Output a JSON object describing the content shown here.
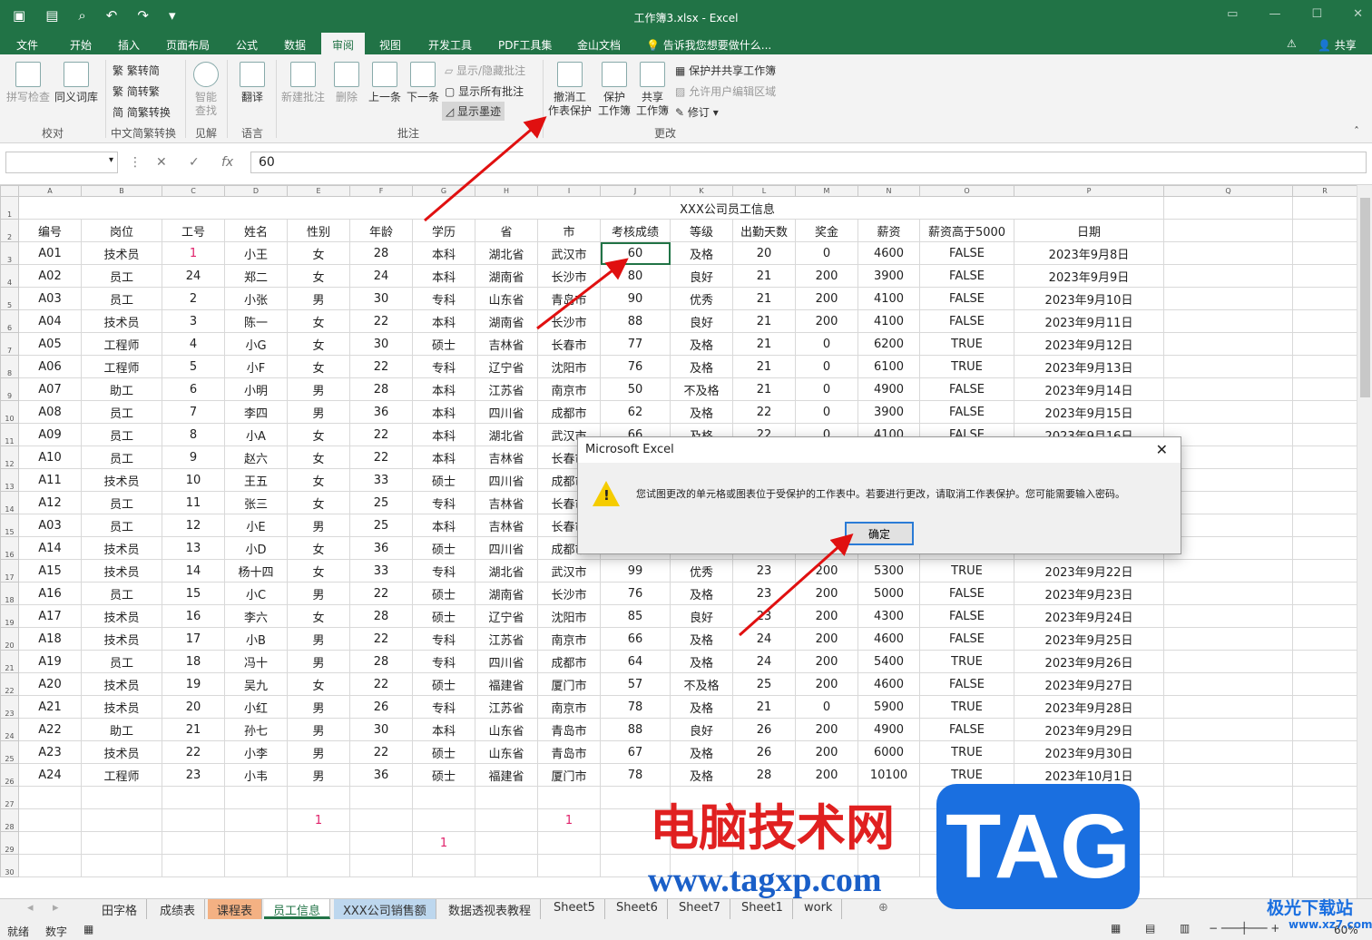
{
  "window": {
    "title": "工作簿3.xlsx - Excel"
  },
  "menu": [
    "文件",
    "开始",
    "插入",
    "页面布局",
    "公式",
    "数据",
    "审阅",
    "视图",
    "开发工具",
    "PDF工具集",
    "金山文档"
  ],
  "tell_me": "告诉我您想要做什么...",
  "share": "共享",
  "ribbon": {
    "spell": "拼写检查",
    "thesaurus": "同义词库",
    "group_proof": "校对",
    "t2s": "繁转简",
    "s2t": "简转繁",
    "conv": "简繁转换",
    "group_chinese": "中文简繁转换",
    "smart1": "智能",
    "smart2": "查找",
    "group_insight": "见解",
    "translate": "翻译",
    "group_lang": "语言",
    "new_comment": "新建批注",
    "delete": "删除",
    "prev": "上一条",
    "next": "下一条",
    "show_hide": "显示/隐藏批注",
    "show_all": "显示所有批注",
    "show_ink": "显示墨迹",
    "group_comments": "批注",
    "unprotect1": "撤消工",
    "unprotect2": "作表保护",
    "protect1": "保护",
    "protect2": "工作簿",
    "share1": "共享",
    "share2": "工作簿",
    "protect_share": "保护并共享工作簿",
    "allow_edit": "允许用户编辑区域",
    "track": "修订",
    "group_changes": "更改"
  },
  "formula": {
    "value": "60"
  },
  "columns": [
    "A",
    "B",
    "C",
    "D",
    "E",
    "F",
    "G",
    "H",
    "I",
    "J",
    "K",
    "L",
    "M",
    "N",
    "O",
    "P",
    "Q",
    "R"
  ],
  "sheet_title": "XXX公司员工信息",
  "headers": [
    "编号",
    "岗位",
    "工号",
    "姓名",
    "性别",
    "年龄",
    "学历",
    "省",
    "市",
    "考核成绩",
    "等级",
    "出勤天数",
    "奖金",
    "薪资",
    "薪资高于5000",
    "日期"
  ],
  "rows": [
    [
      "A01",
      "技术员",
      "1",
      "小王",
      "女",
      "28",
      "本科",
      "湖北省",
      "武汉市",
      "60",
      "及格",
      "20",
      "0",
      "4600",
      "FALSE",
      "2023年9月8日"
    ],
    [
      "A02",
      "员工",
      "24",
      "郑二",
      "女",
      "24",
      "本科",
      "湖南省",
      "长沙市",
      "80",
      "良好",
      "21",
      "200",
      "3900",
      "FALSE",
      "2023年9月9日"
    ],
    [
      "A03",
      "员工",
      "2",
      "小张",
      "男",
      "30",
      "专科",
      "山东省",
      "青岛市",
      "90",
      "优秀",
      "21",
      "200",
      "4100",
      "FALSE",
      "2023年9月10日"
    ],
    [
      "A04",
      "技术员",
      "3",
      "陈一",
      "女",
      "22",
      "本科",
      "湖南省",
      "长沙市",
      "88",
      "良好",
      "21",
      "200",
      "4100",
      "FALSE",
      "2023年9月11日"
    ],
    [
      "A05",
      "工程师",
      "4",
      "小G",
      "女",
      "30",
      "硕士",
      "吉林省",
      "长春市",
      "77",
      "及格",
      "21",
      "0",
      "6200",
      "TRUE",
      "2023年9月12日"
    ],
    [
      "A06",
      "工程师",
      "5",
      "小F",
      "女",
      "22",
      "专科",
      "辽宁省",
      "沈阳市",
      "76",
      "及格",
      "21",
      "0",
      "6100",
      "TRUE",
      "2023年9月13日"
    ],
    [
      "A07",
      "助工",
      "6",
      "小明",
      "男",
      "28",
      "本科",
      "江苏省",
      "南京市",
      "50",
      "不及格",
      "21",
      "0",
      "4900",
      "FALSE",
      "2023年9月14日"
    ],
    [
      "A08",
      "员工",
      "7",
      "李四",
      "男",
      "36",
      "本科",
      "四川省",
      "成都市",
      "62",
      "及格",
      "22",
      "0",
      "3900",
      "FALSE",
      "2023年9月15日"
    ],
    [
      "A09",
      "员工",
      "8",
      "小A",
      "女",
      "22",
      "本科",
      "湖北省",
      "武汉市",
      "66",
      "及格",
      "22",
      "0",
      "4100",
      "FALSE",
      "2023年9月16日"
    ],
    [
      "A10",
      "员工",
      "9",
      "赵六",
      "女",
      "22",
      "本科",
      "吉林省",
      "长春市",
      "",
      "",
      "",
      "",
      "",
      "",
      ""
    ],
    [
      "A11",
      "技术员",
      "10",
      "王五",
      "女",
      "33",
      "硕士",
      "四川省",
      "成都市",
      "",
      "",
      "",
      "",
      "",
      "",
      ""
    ],
    [
      "A12",
      "员工",
      "11",
      "张三",
      "女",
      "25",
      "专科",
      "吉林省",
      "长春市",
      "",
      "",
      "",
      "",
      "",
      "",
      ""
    ],
    [
      "A03",
      "员工",
      "12",
      "小E",
      "男",
      "25",
      "本科",
      "吉林省",
      "长春市",
      "",
      "",
      "",
      "",
      "",
      "",
      ""
    ],
    [
      "A14",
      "技术员",
      "13",
      "小D",
      "女",
      "36",
      "硕士",
      "四川省",
      "成都市",
      "",
      "",
      "",
      "",
      "",
      "",
      ""
    ],
    [
      "A15",
      "技术员",
      "14",
      "杨十四",
      "女",
      "33",
      "专科",
      "湖北省",
      "武汉市",
      "99",
      "优秀",
      "23",
      "200",
      "5300",
      "TRUE",
      "2023年9月22日"
    ],
    [
      "A16",
      "员工",
      "15",
      "小C",
      "男",
      "22",
      "硕士",
      "湖南省",
      "长沙市",
      "76",
      "及格",
      "23",
      "200",
      "5000",
      "FALSE",
      "2023年9月23日"
    ],
    [
      "A17",
      "技术员",
      "16",
      "李六",
      "女",
      "28",
      "硕士",
      "辽宁省",
      "沈阳市",
      "85",
      "良好",
      "23",
      "200",
      "4300",
      "FALSE",
      "2023年9月24日"
    ],
    [
      "A18",
      "技术员",
      "17",
      "小B",
      "男",
      "22",
      "专科",
      "江苏省",
      "南京市",
      "66",
      "及格",
      "24",
      "200",
      "4600",
      "FALSE",
      "2023年9月25日"
    ],
    [
      "A19",
      "员工",
      "18",
      "冯十",
      "男",
      "28",
      "专科",
      "四川省",
      "成都市",
      "64",
      "及格",
      "24",
      "200",
      "5400",
      "TRUE",
      "2023年9月26日"
    ],
    [
      "A20",
      "技术员",
      "19",
      "吴九",
      "女",
      "22",
      "硕士",
      "福建省",
      "厦门市",
      "57",
      "不及格",
      "25",
      "200",
      "4600",
      "FALSE",
      "2023年9月27日"
    ],
    [
      "A21",
      "技术员",
      "20",
      "小红",
      "男",
      "26",
      "专科",
      "江苏省",
      "南京市",
      "78",
      "及格",
      "21",
      "0",
      "5900",
      "TRUE",
      "2023年9月28日"
    ],
    [
      "A22",
      "助工",
      "21",
      "孙七",
      "男",
      "30",
      "本科",
      "山东省",
      "青岛市",
      "88",
      "良好",
      "26",
      "200",
      "4900",
      "FALSE",
      "2023年9月29日"
    ],
    [
      "A23",
      "技术员",
      "22",
      "小李",
      "男",
      "22",
      "硕士",
      "山东省",
      "青岛市",
      "67",
      "及格",
      "26",
      "200",
      "6000",
      "TRUE",
      "2023年9月30日"
    ],
    [
      "A24",
      "工程师",
      "23",
      "小韦",
      "男",
      "36",
      "硕士",
      "福建省",
      "厦门市",
      "78",
      "及格",
      "28",
      "200",
      "10100",
      "TRUE",
      "2023年10月1日"
    ]
  ],
  "extra": {
    "e28": "1",
    "i28": "1",
    "g29": "1"
  },
  "sheets": [
    "田字格",
    "成绩表",
    "课程表",
    "员工信息",
    "XXX公司销售额",
    "数据透视表教程",
    "Sheet5",
    "Sheet6",
    "Sheet7",
    "Sheet1",
    "work"
  ],
  "status": {
    "ready": "就绪",
    "mode": "数字",
    "zoom": "60%"
  },
  "dialog": {
    "title": "Microsoft Excel",
    "message": "您试图更改的单元格或图表位于受保护的工作表中。若要进行更改，请取消工作表保护。您可能需要输入密码。",
    "ok": "确定"
  },
  "watermark": {
    "site1": "电脑技术网",
    "tag": "TAG",
    "url": "www.tagxp.com",
    "site2": "极光下载站",
    "url2": "www.xz7.com"
  },
  "colors": {
    "excel_green": "#217346",
    "arrow": "#e01010",
    "pink": "#e0226b"
  }
}
